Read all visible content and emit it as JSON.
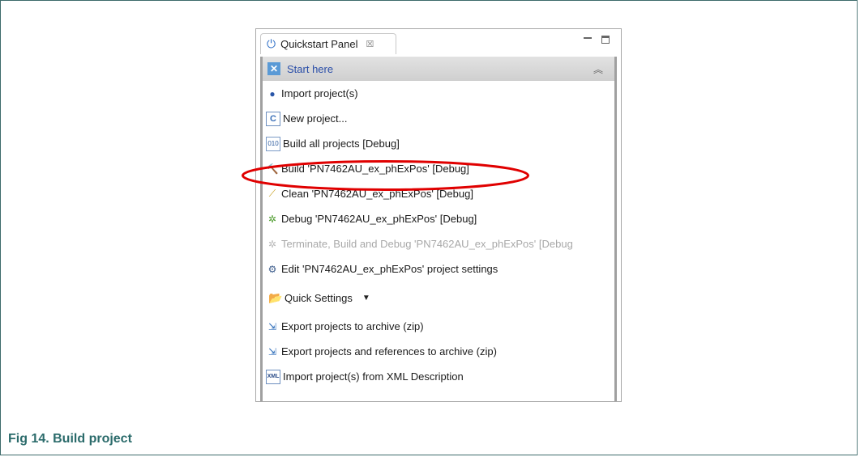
{
  "panel": {
    "tab_title": "Quickstart Panel",
    "tab_close": "☒",
    "section_title": "Start here",
    "items": [
      {
        "label": "Import project(s)",
        "icon": "import-icon",
        "disabled": false
      },
      {
        "label": "New project...",
        "icon": "new-project-icon",
        "disabled": false
      },
      {
        "label": "Build all projects [Debug]",
        "icon": "build-all-icon",
        "disabled": false
      },
      {
        "label": "Build 'PN7462AU_ex_phExPos' [Debug]",
        "icon": "hammer-icon",
        "disabled": false
      },
      {
        "label": "Clean 'PN7462AU_ex_phExPos' [Debug]",
        "icon": "broom-icon",
        "disabled": false
      },
      {
        "label": "Debug 'PN7462AU_ex_phExPos' [Debug]",
        "icon": "bug-icon",
        "disabled": false
      },
      {
        "label": "Terminate, Build and Debug 'PN7462AU_ex_phExPos' [Debug",
        "icon": "bug-disabled-icon",
        "disabled": true
      },
      {
        "label": "Edit 'PN7462AU_ex_phExPos' project settings",
        "icon": "settings-icon",
        "disabled": false
      }
    ],
    "quick_settings": "Quick Settings",
    "items2": [
      {
        "label": "Export projects to archive (zip)",
        "icon": "export-icon"
      },
      {
        "label": "Export projects and references to archive (zip)",
        "icon": "export-icon"
      },
      {
        "label": "Import project(s) from XML Description",
        "icon": "xml-icon"
      }
    ]
  },
  "caption": "Fig 14.   Build project",
  "colors": {
    "highlight": "#e00000",
    "caption": "#2b6b6b",
    "section_text": "#2a4ea8"
  }
}
